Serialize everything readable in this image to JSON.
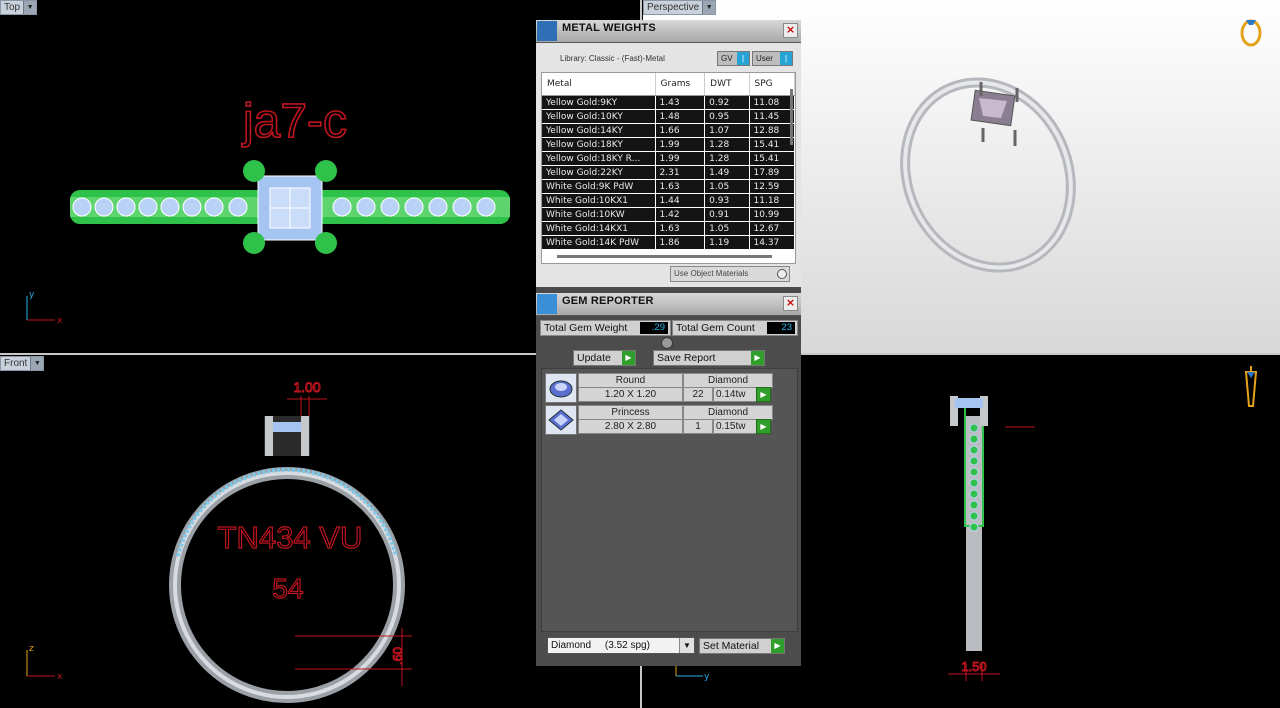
{
  "viewports": {
    "top": {
      "label": "Top",
      "annotation": "ja7-c",
      "axis_x": "x",
      "axis_y": "y"
    },
    "perspective": {
      "label": "Perspective"
    },
    "front": {
      "label": "Front",
      "dim_top": "1.00",
      "text_line1": "TN434 VU",
      "text_line2": "54",
      "dim_side": ".60",
      "axis_x": "x",
      "axis_z": "z"
    },
    "right": {
      "dim_bottom": "1.50",
      "axis_y": "y"
    }
  },
  "metal_weights": {
    "title": "METAL WEIGHTS",
    "library": "Library: Classic - (Fast)-Metal",
    "toggle_gv": "GV",
    "toggle_user": "User",
    "columns": [
      "Metal",
      "Grams",
      "DWT",
      "SPG"
    ],
    "rows": [
      [
        "Yellow Gold:9KY",
        "1.43",
        "0.92",
        "11.08"
      ],
      [
        "Yellow Gold:10KY",
        "1.48",
        "0.95",
        "11.45"
      ],
      [
        "Yellow Gold:14KY",
        "1.66",
        "1.07",
        "12.88"
      ],
      [
        "Yellow Gold:18KY",
        "1.99",
        "1.28",
        "15.41"
      ],
      [
        "Yellow Gold:18KY R...",
        "1.99",
        "1.28",
        "15.41"
      ],
      [
        "Yellow Gold:22KY",
        "2.31",
        "1.49",
        "17.89"
      ],
      [
        "White Gold:9K PdW",
        "1.63",
        "1.05",
        "12.59"
      ],
      [
        "White Gold:10KX1",
        "1.44",
        "0.93",
        "11.18"
      ],
      [
        "White Gold:10KW",
        "1.42",
        "0.91",
        "10.99"
      ],
      [
        "White Gold:14KX1",
        "1.63",
        "1.05",
        "12.67"
      ],
      [
        "White Gold:14K PdW",
        "1.86",
        "1.19",
        "14.37"
      ]
    ],
    "use_object_materials": "Use Object Materials"
  },
  "gem_reporter": {
    "title": "GEM REPORTER",
    "total_weight_label": "Total Gem Weight",
    "total_weight_value": ".29",
    "total_count_label": "Total Gem Count",
    "total_count_value": "23",
    "update_label": "Update",
    "save_report_label": "Save Report",
    "gems": [
      {
        "shape": "Round",
        "material": "Diamond",
        "size": "1.20 X 1.20",
        "count": "22",
        "weight": "0.14tw"
      },
      {
        "shape": "Princess",
        "material": "Diamond",
        "size": "2.80 X 2.80",
        "count": "1",
        "weight": "0.15tw"
      }
    ],
    "material_select": "Diamond     (3.52 spg)",
    "set_material_label": "Set Material"
  },
  "colors": {
    "accent_blue": "#27a4d6",
    "go_green": "#2f9e2a",
    "annotation_red": "#c0141e",
    "gem_green": "#2ec24a"
  }
}
